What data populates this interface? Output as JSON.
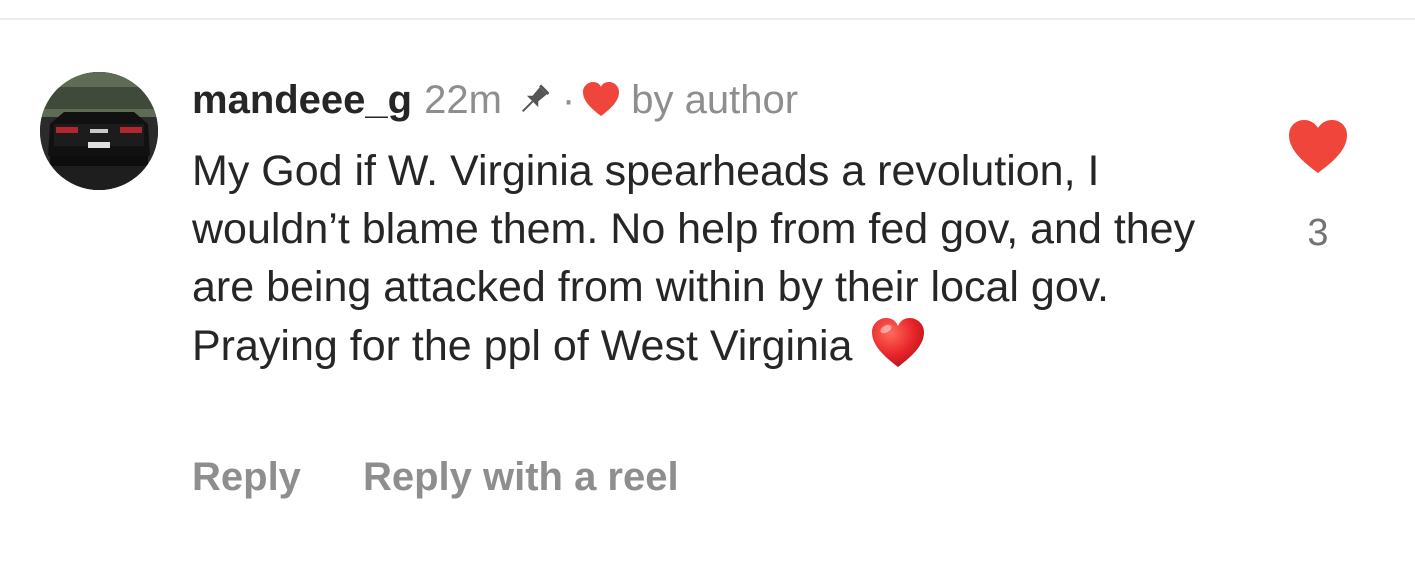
{
  "comment": {
    "username": "mandeee_g",
    "time": "22m",
    "separator": "·",
    "by_author": "by author",
    "text": "My God if W. Virginia spearheads a revolution, I wouldn’t blame them. No help from fed gov, and they are being attacked from within by their local gov.  Praying for the ppl of West Virginia",
    "emoji": "heart-emoji",
    "like_count": "3"
  },
  "actions": {
    "reply_label": "Reply",
    "reply_reel_label": "Reply with a reel"
  },
  "icons": {
    "pin": "pin-icon",
    "author_heart": "heart-icon",
    "like": "heart-like-icon"
  },
  "colors": {
    "heart_red": "#f0453a",
    "text_primary": "#262626",
    "text_secondary": "#8e8e8e"
  }
}
